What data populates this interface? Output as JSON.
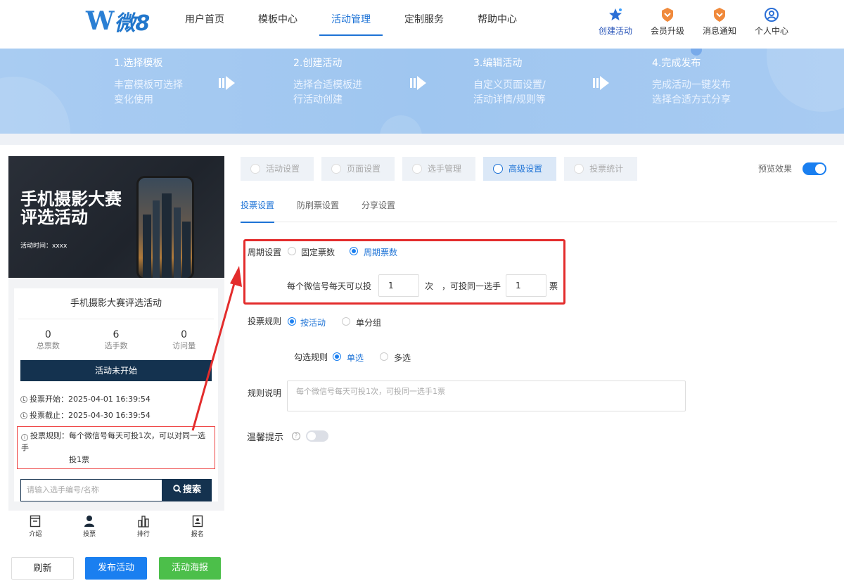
{
  "logo": {
    "mark": "W",
    "text": "微8"
  },
  "nav": {
    "items": [
      {
        "label": "用户首页",
        "active": false
      },
      {
        "label": "模板中心",
        "active": false
      },
      {
        "label": "活动管理",
        "active": true
      },
      {
        "label": "定制服务",
        "active": false
      },
      {
        "label": "帮助中心",
        "active": false
      }
    ]
  },
  "tools": {
    "create": "创建活动",
    "vip": "会员升级",
    "notice": "消息通知",
    "profile": "个人中心"
  },
  "steps": [
    {
      "title": "1.选择模板",
      "desc1": "丰富模板可选择",
      "desc2": "变化使用"
    },
    {
      "title": "2.创建活动",
      "desc1": "选择合适模板进",
      "desc2": "行活动创建"
    },
    {
      "title": "3.编辑活动",
      "desc1": "自定义页面设置/",
      "desc2": "活动详情/规则等"
    },
    {
      "title": "4.完成发布",
      "desc1": "完成活动一键发布",
      "desc2": "选择合适方式分享"
    }
  ],
  "preview": {
    "poster_title_1": "手机摄影大赛",
    "poster_title_2": "评选活动",
    "poster_time": "活动时间：xxxx",
    "card_title": "手机摄影大赛评选活动",
    "stats": [
      {
        "value": "0",
        "label": "总票数"
      },
      {
        "value": "6",
        "label": "选手数"
      },
      {
        "value": "0",
        "label": "访问量"
      }
    ],
    "status": "活动未开始",
    "vote_start": "投票开始：2025-04-01 16:39:54",
    "vote_end": "投票截止：2025-04-30 16:39:54",
    "rule_line1": "投票规则：每个微信号每天可投1次，可以对同一选手",
    "rule_line2": "投1票",
    "search_placeholder": "请输入选手编号/名称",
    "search_button": "搜索",
    "tabbar": [
      "介绍",
      "投票",
      "排行",
      "报名"
    ]
  },
  "actions": {
    "refresh": "刷新",
    "publish": "发布活动",
    "poster": "活动海报"
  },
  "top_tabs": [
    {
      "label": "活动设置",
      "active": false
    },
    {
      "label": "页面设置",
      "active": false
    },
    {
      "label": "选手管理",
      "active": false
    },
    {
      "label": "高级设置",
      "active": true
    },
    {
      "label": "投票统计",
      "active": false
    }
  ],
  "preview_toggle": "预览效果",
  "sub_tabs": [
    {
      "label": "投票设置",
      "active": true
    },
    {
      "label": "防刷票设置",
      "active": false
    },
    {
      "label": "分享设置",
      "active": false
    }
  ],
  "form": {
    "period_label": "周期设置",
    "period_fixed": "固定票数",
    "period_cycle": "周期票数",
    "per_day_prefix": "每个微信号每天可以投",
    "per_day_value": "1",
    "per_day_unit": "次",
    "same_prefix": "，可投同一选手",
    "same_value": "1",
    "same_unit": "票",
    "rule_label": "投票规则",
    "rule_by_activity": "按活动",
    "rule_by_group": "单分组",
    "check_label": "勾选规则",
    "check_single": "单选",
    "check_multi": "多选",
    "desc_label": "规则说明",
    "desc_placeholder": "每个微信号每天可投1次，可投同一选手1票",
    "tip_label": "温馨提示"
  }
}
